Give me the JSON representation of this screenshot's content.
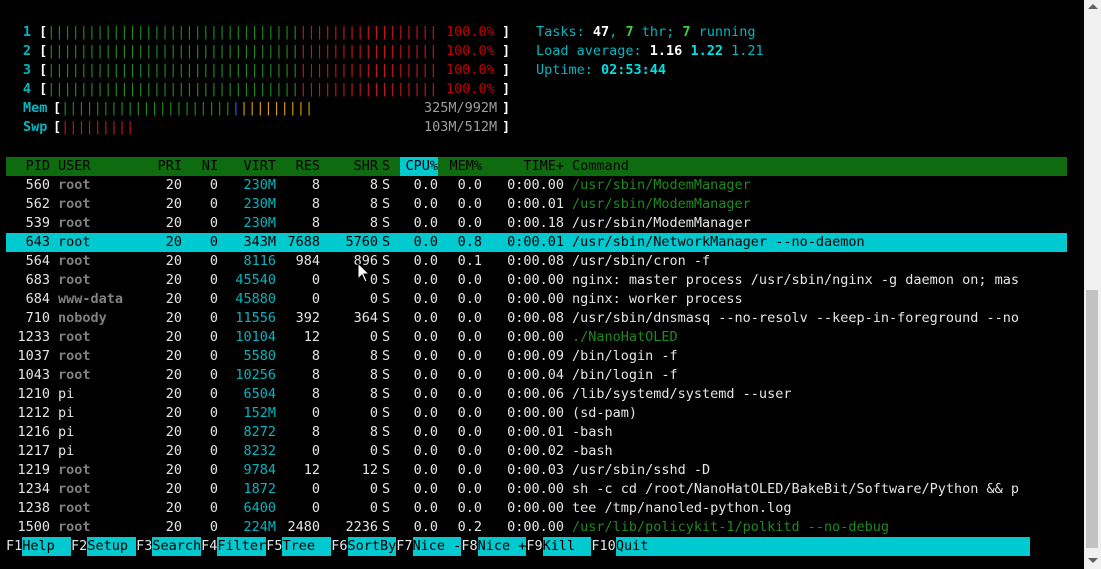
{
  "meters": {
    "cpu": [
      {
        "label": "1",
        "value": "100.0%",
        "green": 31,
        "red": 18
      },
      {
        "label": "2",
        "value": "100.0%",
        "green": 31,
        "red": 18
      },
      {
        "label": "3",
        "value": "100.0%",
        "green": 31,
        "red": 18
      },
      {
        "label": "4",
        "value": "100.0%",
        "green": 31,
        "red": 18
      }
    ],
    "mem": {
      "label": "Mem",
      "value": "325M/992M"
    },
    "swp": {
      "label": "Swp",
      "value": "103M/512M"
    }
  },
  "stats": {
    "tasks_label": "Tasks: ",
    "tasks": "47",
    "sep1": ", ",
    "threads": "7",
    "thr_label": " thr; ",
    "running": "7",
    "running_label": " running",
    "load_label": "Load average: ",
    "load1": "1.16",
    "load5": "1.22",
    "load15": "1.21",
    "uptime_label": "Uptime: ",
    "uptime": "02:53:44"
  },
  "columns": {
    "pid": "PID",
    "user": "USER",
    "pri": "PRI",
    "ni": "NI",
    "virt": "VIRT",
    "res": "RES",
    "shr": "SHR",
    "s": "S",
    "cpu": "CPU%",
    "mem": "MEM%",
    "time": "TIME+",
    "cmd": "Command"
  },
  "processes": [
    {
      "pid": "560",
      "user": "root",
      "pri": "20",
      "ni": "0",
      "virt": "230M",
      "res": "8",
      "shr": "8",
      "s": "S",
      "cpu": "0.0",
      "mem": "0.0",
      "time": "0:00.00",
      "cmd": "/usr/sbin/ModemManager"
    },
    {
      "pid": "562",
      "user": "root",
      "pri": "20",
      "ni": "0",
      "virt": "230M",
      "res": "8",
      "shr": "8",
      "s": "S",
      "cpu": "0.0",
      "mem": "0.0",
      "time": "0:00.01",
      "cmd": "/usr/sbin/ModemManager"
    },
    {
      "pid": "539",
      "user": "root",
      "pri": "20",
      "ni": "0",
      "virt": "230M",
      "res": "8",
      "shr": "8",
      "s": "S",
      "cpu": "0.0",
      "mem": "0.0",
      "time": "0:00.18",
      "cmd": "/usr/sbin/ModemManager"
    },
    {
      "pid": "643",
      "user": "root",
      "pri": "20",
      "ni": "0",
      "virt": "343M",
      "res": "7688",
      "shr": "5760",
      "s": "S",
      "cpu": "0.0",
      "mem": "0.8",
      "time": "0:00.01",
      "cmd": "/usr/sbin/NetworkManager --no-daemon"
    },
    {
      "pid": "564",
      "user": "root",
      "pri": "20",
      "ni": "0",
      "virt": "8116",
      "res": "984",
      "shr": "896",
      "s": "S",
      "cpu": "0.0",
      "mem": "0.1",
      "time": "0:00.08",
      "cmd": "/usr/sbin/cron -f"
    },
    {
      "pid": "683",
      "user": "root",
      "pri": "20",
      "ni": "0",
      "virt": "45540",
      "res": "0",
      "shr": "0",
      "s": "S",
      "cpu": "0.0",
      "mem": "0.0",
      "time": "0:00.00",
      "cmd": "nginx: master process /usr/sbin/nginx -g daemon on; mas"
    },
    {
      "pid": "684",
      "user": "www-data",
      "pri": "20",
      "ni": "0",
      "virt": "45880",
      "res": "0",
      "shr": "0",
      "s": "S",
      "cpu": "0.0",
      "mem": "0.0",
      "time": "0:00.00",
      "cmd": "nginx: worker process"
    },
    {
      "pid": "710",
      "user": "nobody",
      "pri": "20",
      "ni": "0",
      "virt": "11556",
      "res": "392",
      "shr": "364",
      "s": "S",
      "cpu": "0.0",
      "mem": "0.0",
      "time": "0:00.08",
      "cmd": "/usr/sbin/dnsmasq --no-resolv --keep-in-foreground --no"
    },
    {
      "pid": "1233",
      "user": "root",
      "pri": "20",
      "ni": "0",
      "virt": "10104",
      "res": "12",
      "shr": "0",
      "s": "S",
      "cpu": "0.0",
      "mem": "0.0",
      "time": "0:00.00",
      "cmd": "./NanoHatOLED"
    },
    {
      "pid": "1037",
      "user": "root",
      "pri": "20",
      "ni": "0",
      "virt": "5580",
      "res": "8",
      "shr": "8",
      "s": "S",
      "cpu": "0.0",
      "mem": "0.0",
      "time": "0:00.09",
      "cmd": "/bin/login -f"
    },
    {
      "pid": "1043",
      "user": "root",
      "pri": "20",
      "ni": "0",
      "virt": "10256",
      "res": "8",
      "shr": "8",
      "s": "S",
      "cpu": "0.0",
      "mem": "0.0",
      "time": "0:00.04",
      "cmd": "/bin/login -f"
    },
    {
      "pid": "1210",
      "user": "pi",
      "pri": "20",
      "ni": "0",
      "virt": "6504",
      "res": "8",
      "shr": "8",
      "s": "S",
      "cpu": "0.0",
      "mem": "0.0",
      "time": "0:00.06",
      "cmd": "/lib/systemd/systemd --user"
    },
    {
      "pid": "1212",
      "user": "pi",
      "pri": "20",
      "ni": "0",
      "virt": "152M",
      "res": "0",
      "shr": "0",
      "s": "S",
      "cpu": "0.0",
      "mem": "0.0",
      "time": "0:00.00",
      "cmd": "(sd-pam)"
    },
    {
      "pid": "1216",
      "user": "pi",
      "pri": "20",
      "ni": "0",
      "virt": "8272",
      "res": "8",
      "shr": "8",
      "s": "S",
      "cpu": "0.0",
      "mem": "0.0",
      "time": "0:00.01",
      "cmd": "-bash"
    },
    {
      "pid": "1217",
      "user": "pi",
      "pri": "20",
      "ni": "0",
      "virt": "8232",
      "res": "0",
      "shr": "0",
      "s": "S",
      "cpu": "0.0",
      "mem": "0.0",
      "time": "0:00.02",
      "cmd": "-bash"
    },
    {
      "pid": "1219",
      "user": "root",
      "pri": "20",
      "ni": "0",
      "virt": "9784",
      "res": "12",
      "shr": "12",
      "s": "S",
      "cpu": "0.0",
      "mem": "0.0",
      "time": "0:00.03",
      "cmd": "/usr/sbin/sshd -D"
    },
    {
      "pid": "1234",
      "user": "root",
      "pri": "20",
      "ni": "0",
      "virt": "1872",
      "res": "0",
      "shr": "0",
      "s": "S",
      "cpu": "0.0",
      "mem": "0.0",
      "time": "0:00.00",
      "cmd": "sh -c cd /root/NanoHatOLED/BakeBit/Software/Python && p"
    },
    {
      "pid": "1238",
      "user": "root",
      "pri": "20",
      "ni": "0",
      "virt": "6400",
      "res": "0",
      "shr": "0",
      "s": "S",
      "cpu": "0.0",
      "mem": "0.0",
      "time": "0:00.00",
      "cmd": "tee /tmp/nanoled-python.log"
    },
    {
      "pid": "1500",
      "user": "root",
      "pri": "20",
      "ni": "0",
      "virt": "224M",
      "res": "2480",
      "shr": "2236",
      "s": "S",
      "cpu": "0.0",
      "mem": "0.2",
      "time": "0:00.00",
      "cmd": "/usr/lib/policykit-1/polkitd --no-debug"
    }
  ],
  "footer": [
    {
      "key": "F1",
      "label": "Help  "
    },
    {
      "key": "F2",
      "label": "Setup "
    },
    {
      "key": "F3",
      "label": "Search"
    },
    {
      "key": "F4",
      "label": "Filter"
    },
    {
      "key": "F5",
      "label": "Tree  "
    },
    {
      "key": "F6",
      "label": "SortBy"
    },
    {
      "key": "F7",
      "label": "Nice -"
    },
    {
      "key": "F8",
      "label": "Nice +"
    },
    {
      "key": "F9",
      "label": "Kill  "
    },
    {
      "key": "F10",
      "label": "Quit"
    }
  ],
  "colors": {
    "accent_cyan": "#00c9cf",
    "header_green": "#0f6b0f",
    "bar_green": "#1e8a1e",
    "bar_red": "#c81414",
    "background": "#000000"
  }
}
